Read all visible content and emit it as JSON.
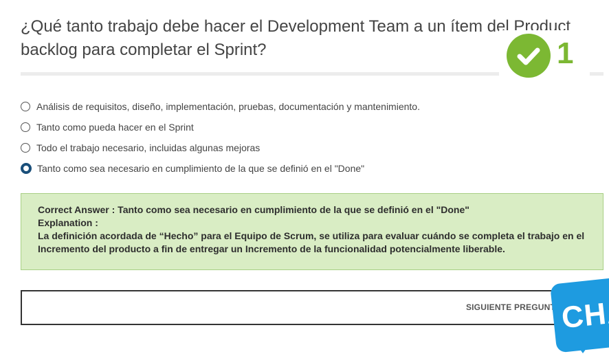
{
  "question": {
    "text": "¿Qué tanto  trabajo debe hacer el Development Team a un ítem del Product backlog para completar el Sprint?"
  },
  "score": {
    "value": "1",
    "icon": "check-icon",
    "color": "#7cb833"
  },
  "options": [
    {
      "label": "Análisis de requisitos, diseño, implementación, pruebas, documentación y mantenimiento.",
      "selected": false
    },
    {
      "label": "Tanto como pueda hacer en el Sprint",
      "selected": false
    },
    {
      "label": "Todo el trabajo necesario, incluidas algunas mejoras",
      "selected": false
    },
    {
      "label": "Tanto como sea necesario en cumplimiento de la que se definió en el \"Done\"",
      "selected": true
    }
  ],
  "answer": {
    "correct": "Correct Answer : Tanto como sea necesario en cumplimiento de la que se definió en el \"Done\"",
    "explanation_label": "Explanation :",
    "explanation_text": "La definición acordada de “Hecho” para el Equipo de Scrum, se utiliza para evaluar cuándo se completa el trabajo en el Incremento del producto a fin de entregar un Incremento de la funcionalidad potencialmente liberable.",
    "background": "#d9edc4"
  },
  "next": {
    "label": "SIGUIENTE PREGUNTA"
  },
  "chat": {
    "label": "CHAT",
    "color": "#1e9be0"
  }
}
